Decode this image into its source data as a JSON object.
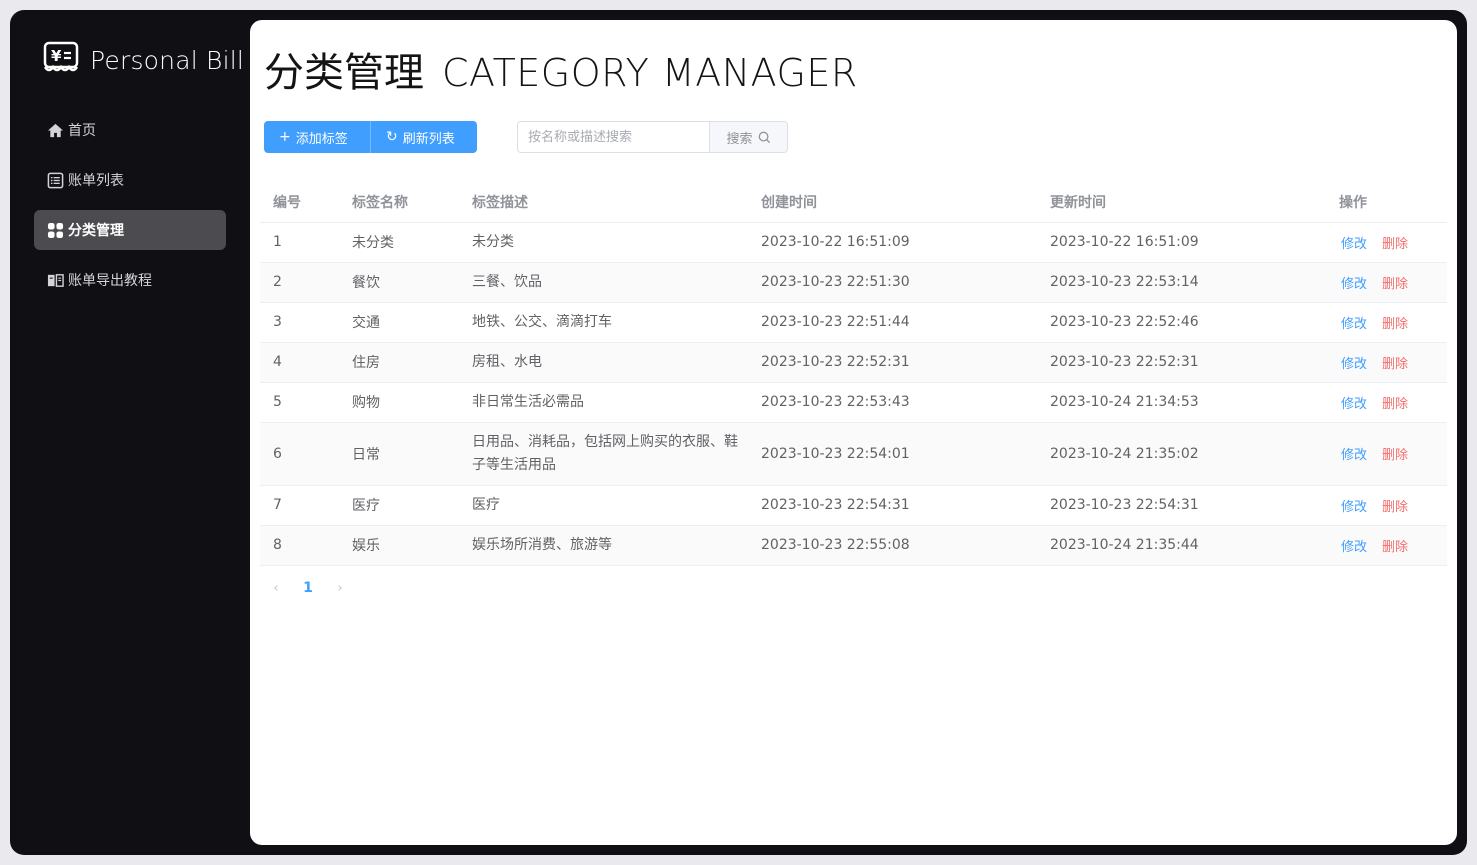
{
  "app": {
    "name": "Personal Bill"
  },
  "sidebar": {
    "items": [
      {
        "label": "首页",
        "icon": "home-icon",
        "active": false
      },
      {
        "label": "账单列表",
        "icon": "list-icon",
        "active": false
      },
      {
        "label": "分类管理",
        "icon": "grid-icon",
        "active": true
      },
      {
        "label": "账单导出教程",
        "icon": "book-icon",
        "active": false
      }
    ]
  },
  "header": {
    "title_cn": "分类管理",
    "title_en": "CATEGORY MANAGER"
  },
  "toolbar": {
    "add_label": "添加标签",
    "refresh_label": "刷新列表",
    "search_placeholder": "按名称或描述搜索",
    "search_button": "搜索"
  },
  "table": {
    "columns": [
      "编号",
      "标签名称",
      "标签描述",
      "创建时间",
      "更新时间",
      "操作"
    ],
    "rows": [
      {
        "id": "1",
        "name": "未分类",
        "desc": "未分类",
        "created": "2023-10-22 16:51:09",
        "updated": "2023-10-22 16:51:09"
      },
      {
        "id": "2",
        "name": "餐饮",
        "desc": "三餐、饮品",
        "created": "2023-10-23 22:51:30",
        "updated": "2023-10-23 22:53:14"
      },
      {
        "id": "3",
        "name": "交通",
        "desc": "地铁、公交、滴滴打车",
        "created": "2023-10-23 22:51:44",
        "updated": "2023-10-23 22:52:46"
      },
      {
        "id": "4",
        "name": "住房",
        "desc": "房租、水电",
        "created": "2023-10-23 22:52:31",
        "updated": "2023-10-23 22:52:31"
      },
      {
        "id": "5",
        "name": "购物",
        "desc": "非日常生活必需品",
        "created": "2023-10-23 22:53:43",
        "updated": "2023-10-24 21:34:53"
      },
      {
        "id": "6",
        "name": "日常",
        "desc": "日用品、消耗品，包括网上购买的衣服、鞋子等生活用品",
        "created": "2023-10-23 22:54:01",
        "updated": "2023-10-24 21:35:02"
      },
      {
        "id": "7",
        "name": "医疗",
        "desc": "医疗",
        "created": "2023-10-23 22:54:31",
        "updated": "2023-10-23 22:54:31"
      },
      {
        "id": "8",
        "name": "娱乐",
        "desc": "娱乐场所消费、旅游等",
        "created": "2023-10-23 22:55:08",
        "updated": "2023-10-24 21:35:44"
      }
    ],
    "actions": {
      "edit": "修改",
      "delete": "删除"
    }
  },
  "pagination": {
    "current": "1"
  },
  "colors": {
    "primary": "#409eff",
    "danger": "#f56c6c",
    "sidebar_bg": "#0f0f14",
    "active_item": "#4b4b50"
  }
}
